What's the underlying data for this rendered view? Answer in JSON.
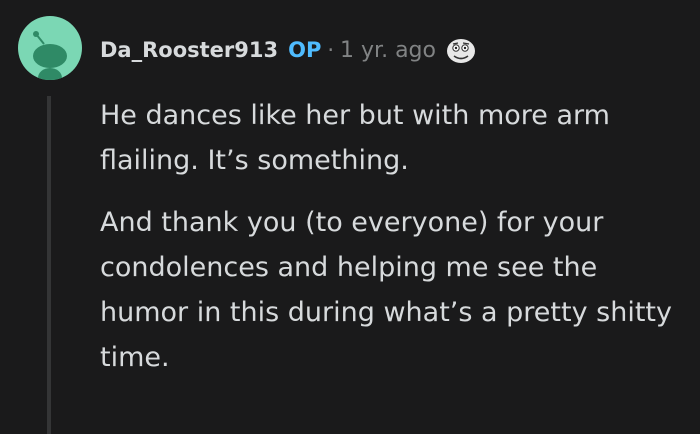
{
  "comment": {
    "author": "Da_Rooster913",
    "op_badge": "OP",
    "separator": "·",
    "time": "1 yr. ago",
    "award_icon": "award-face-icon",
    "avatar_color": "#7bd7b4",
    "paragraphs": [
      "He dances like her but with more arm flailing. It’s something.",
      "And thank you (to everyone) for your condolences and helping me see the humor in this during what’s a pretty shitty time."
    ]
  }
}
